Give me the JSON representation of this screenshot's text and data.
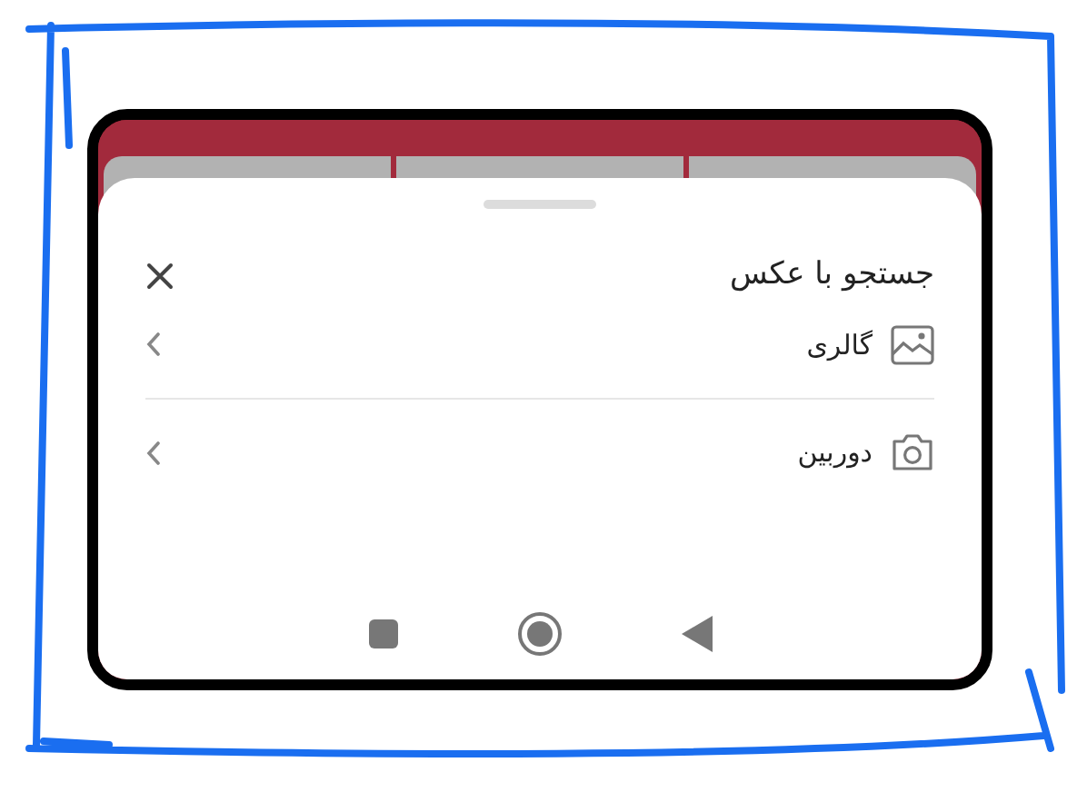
{
  "sheet": {
    "title": "جستجو با عکس",
    "options": [
      {
        "kind": "gallery",
        "label": "گالری"
      },
      {
        "kind": "camera",
        "label": "دوربین"
      }
    ]
  }
}
